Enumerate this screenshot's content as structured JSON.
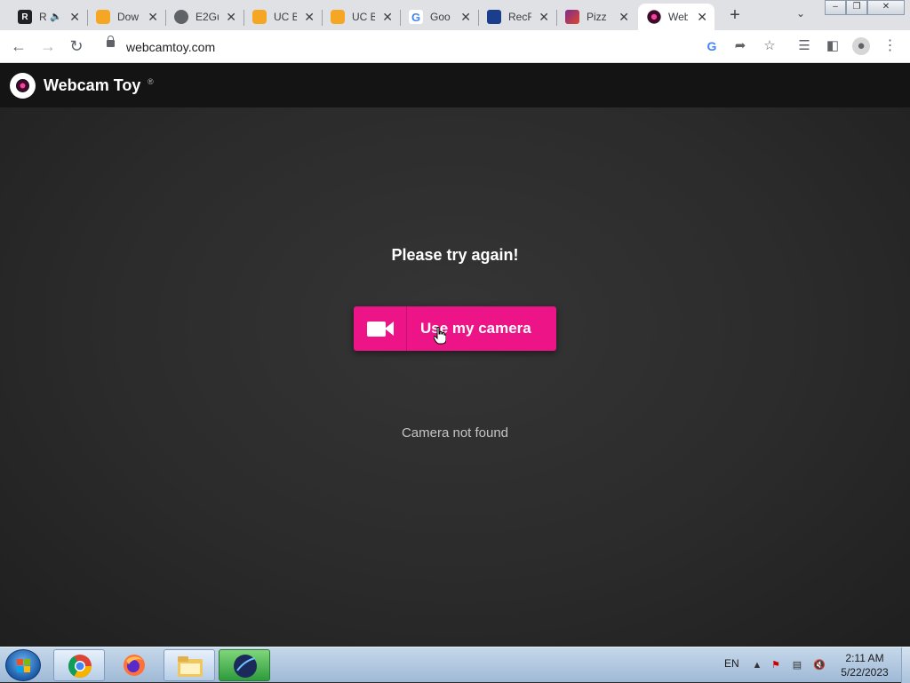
{
  "browser": {
    "tabs": [
      {
        "title": "R",
        "favicon_text": "R",
        "favicon_color": "#202124",
        "audio": true
      },
      {
        "title": "Dow",
        "favicon_text": "",
        "favicon_color": "#f5a623"
      },
      {
        "title": "E2Gu",
        "favicon_text": "",
        "favicon_color": "#5f6368"
      },
      {
        "title": "UC B",
        "favicon_text": "",
        "favicon_color": "#f5a623"
      },
      {
        "title": "UC B",
        "favicon_text": "",
        "favicon_color": "#f5a623"
      },
      {
        "title": "Goo",
        "favicon_text": "G",
        "favicon_color": "#4285f4"
      },
      {
        "title": "RecF",
        "favicon_text": "",
        "favicon_color": "#1a3e8c"
      },
      {
        "title": "Pizz",
        "favicon_text": "",
        "favicon_color": "#7b2d8e"
      },
      {
        "title": "Web",
        "favicon_text": "",
        "favicon_color": "#3a0b2a",
        "active": true
      }
    ],
    "url": "webcamtoy.com"
  },
  "site": {
    "brand": "Webcam Toy",
    "registered_mark": "®",
    "headline": "Please try again!",
    "camera_button_label": "Use my camera",
    "status": "Camera not found"
  },
  "taskbar": {
    "language": "EN",
    "time": "2:11 AM",
    "date": "5/22/2023"
  }
}
